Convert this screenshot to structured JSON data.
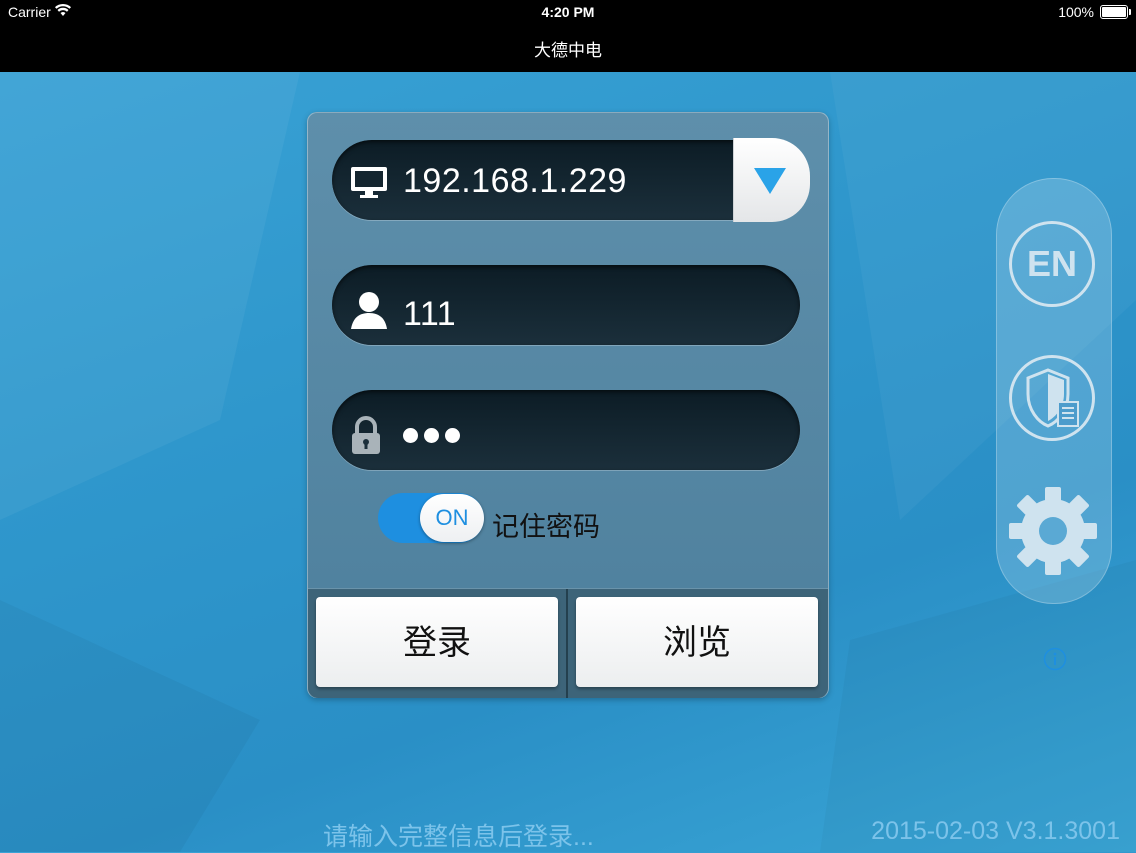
{
  "status_bar": {
    "carrier": "Carrier",
    "time": "4:20 PM",
    "battery": "100%"
  },
  "app": {
    "title": "大德中电"
  },
  "login": {
    "server_address": "192.168.1.229",
    "username": "111",
    "password_masked_length": 3,
    "remember_toggle_state": "ON",
    "remember_label": "记住密码",
    "login_button": "登录",
    "browse_button": "浏览"
  },
  "side_panel": {
    "language_button": "EN",
    "icons": [
      "en-language-icon",
      "shield-document-icon",
      "gear-icon"
    ]
  },
  "info_icon": "info-icon",
  "footer": {
    "hint": "请输入完整信息后登录...",
    "version": "2015-02-03 V3.1.3001"
  },
  "colors": {
    "background": "#2f97cc",
    "toggle_on": "#1e8fe0",
    "footer_text": "#7cc3ea"
  }
}
